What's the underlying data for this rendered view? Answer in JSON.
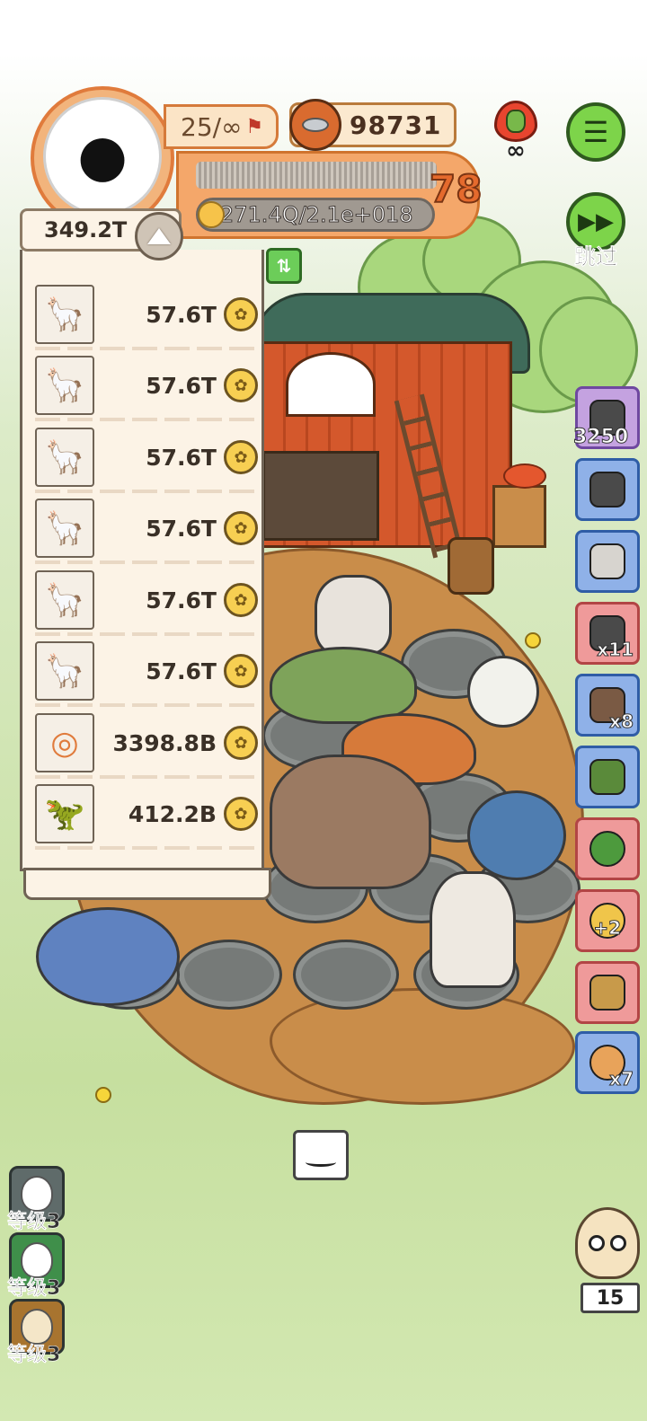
{
  "header": {
    "level_text": "25/∞",
    "coins": "98731",
    "player_level": "78",
    "production": "271.4Q/2.1e+018",
    "skip_label": "跳过"
  },
  "panel": {
    "total": "349.2T",
    "rows": [
      {
        "icon": "alpaca",
        "value": "57.6T"
      },
      {
        "icon": "alpaca",
        "value": "57.6T"
      },
      {
        "icon": "alpaca",
        "value": "57.6T"
      },
      {
        "icon": "alpaca",
        "value": "57.6T"
      },
      {
        "icon": "alpaca",
        "value": "57.6T"
      },
      {
        "icon": "alpaca",
        "value": "57.6T"
      },
      {
        "icon": "donut",
        "value": "3398.8B"
      },
      {
        "icon": "dinosaur",
        "value": "412.2B"
      }
    ]
  },
  "items": [
    {
      "icon": "stone-bag",
      "count": "3250",
      "color": "#c4a2e0"
    },
    {
      "icon": "camera",
      "count": "",
      "color": "#8fb1e8"
    },
    {
      "icon": "jar",
      "count": "",
      "color": "#8fb1e8"
    },
    {
      "icon": "bag",
      "count": "x11",
      "color": "#ef9a9a"
    },
    {
      "icon": "axe",
      "count": "x8",
      "color": "#8fb1e8"
    },
    {
      "icon": "can",
      "count": "",
      "color": "#8fb1e8"
    },
    {
      "icon": "potion",
      "count": "",
      "color": "#ef9a9a"
    },
    {
      "icon": "paw-plus",
      "count": "+2",
      "color": "#ef9a9a"
    },
    {
      "icon": "fossil",
      "count": "",
      "color": "#ef9a9a"
    },
    {
      "icon": "donut",
      "count": "x7",
      "color": "#8fb1e8"
    }
  ],
  "level_slots": [
    {
      "label": "等级3"
    },
    {
      "label": "等级3"
    },
    {
      "label": "等级3"
    }
  ],
  "owl": {
    "count": "15"
  }
}
